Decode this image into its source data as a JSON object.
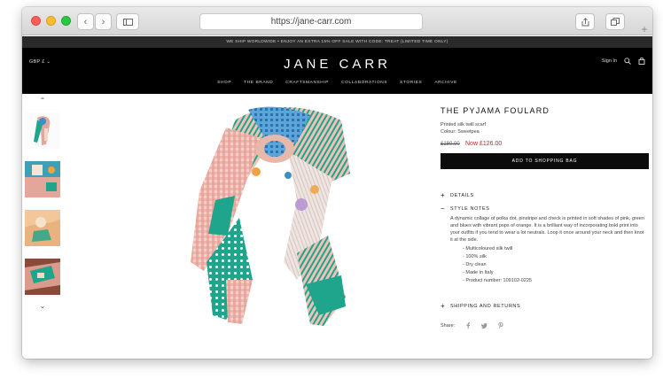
{
  "browser": {
    "url": "https://jane-carr.com",
    "back_glyph": "‹",
    "forward_glyph": "›",
    "new_tab_glyph": "+"
  },
  "promo_bar": {
    "text": "WE SHIP WORLDWIDE • ENJOY AN EXTRA 15% OFF SALE WITH CODE: TREAT (LIMITED TIME ONLY)"
  },
  "header": {
    "currency": "GBP £  ⌄",
    "logo": "JANE CARR",
    "sign_in": "Sign In",
    "icons": [
      "search-icon",
      "bag-icon"
    ],
    "nav": [
      "SHOP",
      "THE BRAND",
      "CRAFTSMANSHIP",
      "COLLABORATIONS",
      "STORIES",
      "ARCHIVE"
    ]
  },
  "gallery": {
    "up_arrow": "⌃",
    "down_arrow": "⌄",
    "thumbnail_count": 4
  },
  "product": {
    "title": "THE PYJAMA FOULARD",
    "subtitle": "Printed silk twill scarf",
    "colour": "Colour: Sweetpea",
    "price_old": "£180.00",
    "price_new": "Now £126.00",
    "add_to_bag": "ADD TO SHOPPING BAG",
    "details_label": "DETAILS",
    "style_notes_label": "STYLE NOTES",
    "style_notes_text": "A dynamic collage of polka dot, pinstripe and check is printed in soft shades of pink, green and blues with vibrant pops of orange. It is a brilliant way of incorporating bold print into your outfits if you tend to wear a lot neutrals. Loop it once around your neck and then knot it at the side.",
    "bullets": [
      "- Multicoloured silk twill",
      "- 100% silk",
      "- Dry clean",
      "- Made in Italy",
      "- Product number: 109102-0225"
    ],
    "shipping_label": "SHIPPING AND RETURNS",
    "plus_sign": "+",
    "minus_sign": "−",
    "share_label": "Share:",
    "share_icons": [
      "facebook-icon",
      "twitter-icon",
      "pinterest-icon"
    ]
  },
  "colors": {
    "header_bg": "#000000",
    "promo_bg": "#2a2a2a",
    "sale_price": "#c0271f",
    "scarf_teal": "#1ea58c",
    "scarf_pink": "#e6a9a0",
    "scarf_blue": "#3c8fc4"
  }
}
